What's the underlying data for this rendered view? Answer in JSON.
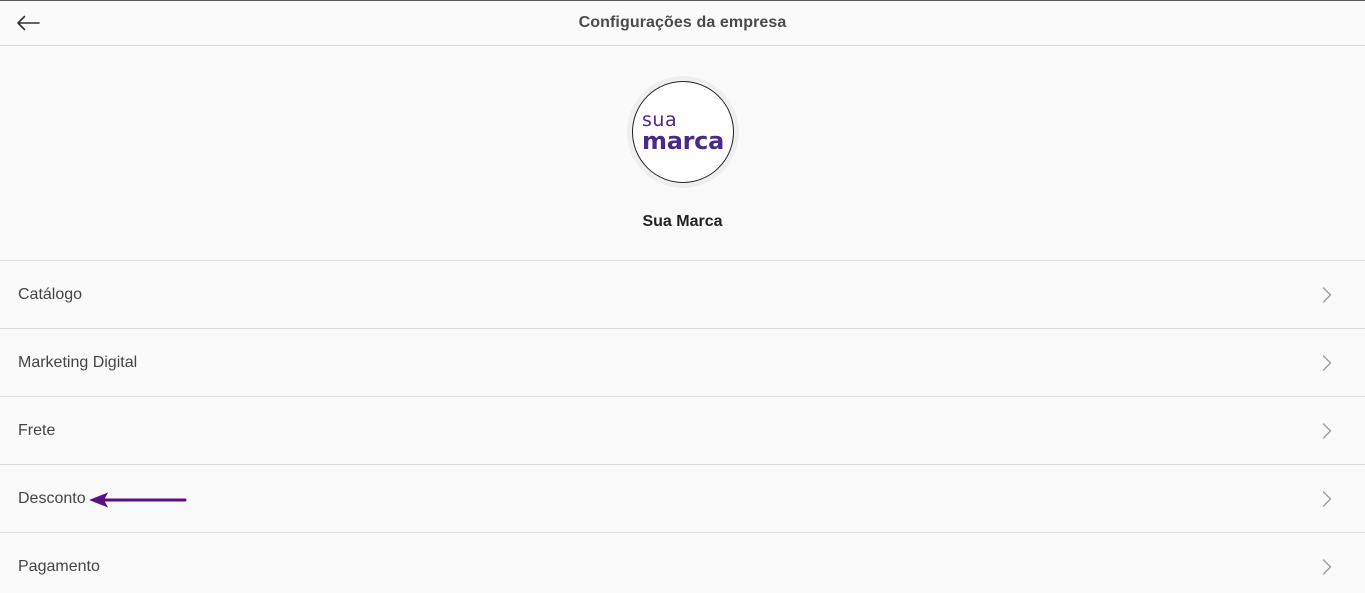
{
  "header": {
    "title": "Configurações da empresa",
    "back_icon": "arrow-left-icon"
  },
  "profile": {
    "logo_text_top": "sua",
    "logo_text_bottom": "marca",
    "company_name": "Sua Marca",
    "brand_color": "#4b2a86"
  },
  "menu": {
    "items": [
      {
        "label": "Catálogo",
        "icon": "chevron-right-icon"
      },
      {
        "label": "Marketing Digital",
        "icon": "chevron-right-icon"
      },
      {
        "label": "Frete",
        "icon": "chevron-right-icon"
      },
      {
        "label": "Desconto",
        "icon": "chevron-right-icon"
      },
      {
        "label": "Pagamento",
        "icon": "chevron-right-icon"
      }
    ]
  },
  "annotation": {
    "arrow_color": "#5b0f82",
    "points_to": "Desconto"
  }
}
